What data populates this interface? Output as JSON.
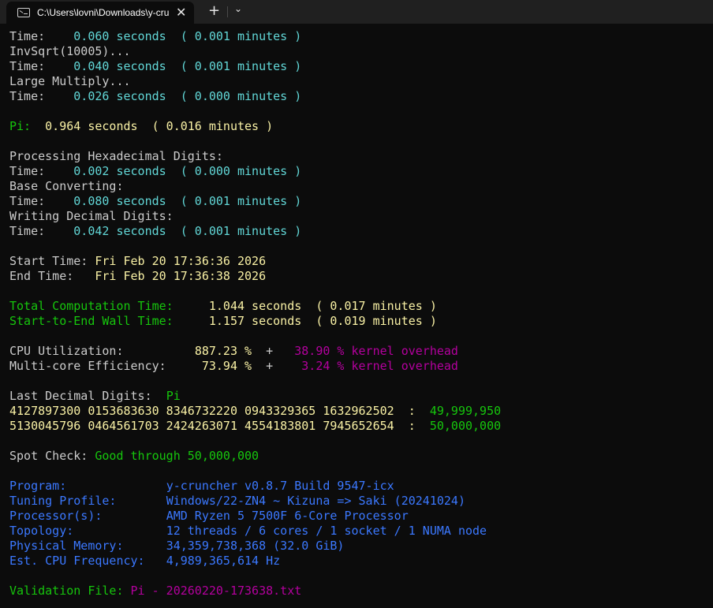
{
  "tab": {
    "title": "C:\\Users\\lovni\\Downloads\\y-cruncher",
    "close_icon": "✕",
    "new_tab_icon": "+",
    "dropdown_icon": "⌄"
  },
  "lines": [
    [
      {
        "t": "Time:    ",
        "c": "w"
      },
      {
        "t": "0.060 seconds  ( 0.001 minutes )",
        "c": "c"
      }
    ],
    [
      {
        "t": "InvSqrt(10005)...",
        "c": "w"
      }
    ],
    [
      {
        "t": "Time:    ",
        "c": "w"
      },
      {
        "t": "0.040 seconds  ( 0.001 minutes )",
        "c": "c"
      }
    ],
    [
      {
        "t": "Large Multiply...",
        "c": "w"
      }
    ],
    [
      {
        "t": "Time:    ",
        "c": "w"
      },
      {
        "t": "0.026 seconds  ( 0.000 minutes )",
        "c": "c"
      }
    ],
    [],
    [
      {
        "t": "Pi:  ",
        "c": "g"
      },
      {
        "t": "0.964 seconds  ( 0.016 minutes )",
        "c": "y"
      }
    ],
    [],
    [
      {
        "t": "Processing Hexadecimal Digits:",
        "c": "w"
      }
    ],
    [
      {
        "t": "Time:    ",
        "c": "w"
      },
      {
        "t": "0.002 seconds  ( 0.000 minutes )",
        "c": "c"
      }
    ],
    [
      {
        "t": "Base Converting:",
        "c": "w"
      }
    ],
    [
      {
        "t": "Time:    ",
        "c": "w"
      },
      {
        "t": "0.080 seconds  ( 0.001 minutes )",
        "c": "c"
      }
    ],
    [
      {
        "t": "Writing Decimal Digits:",
        "c": "w"
      }
    ],
    [
      {
        "t": "Time:    ",
        "c": "w"
      },
      {
        "t": "0.042 seconds  ( 0.001 minutes )",
        "c": "c"
      }
    ],
    [],
    [
      {
        "t": "Start Time: ",
        "c": "w"
      },
      {
        "t": "Fri Feb 20 17:36:36 2026",
        "c": "y"
      }
    ],
    [
      {
        "t": "End Time:   ",
        "c": "w"
      },
      {
        "t": "Fri Feb 20 17:36:38 2026",
        "c": "y"
      }
    ],
    [],
    [
      {
        "t": "Total Computation Time:     ",
        "c": "g"
      },
      {
        "t": "1.044 seconds  ( 0.017 minutes )",
        "c": "y"
      }
    ],
    [
      {
        "t": "Start-to-End Wall Time:     ",
        "c": "g"
      },
      {
        "t": "1.157 seconds  ( 0.019 minutes )",
        "c": "y"
      }
    ],
    [],
    [
      {
        "t": "CPU Utilization:          ",
        "c": "w"
      },
      {
        "t": "887.23 %",
        "c": "y"
      },
      {
        "t": "  +   ",
        "c": "w"
      },
      {
        "t": "38.90 % kernel overhead",
        "c": "m"
      }
    ],
    [
      {
        "t": "Multi-core Efficiency:     ",
        "c": "w"
      },
      {
        "t": "73.94 %",
        "c": "y"
      },
      {
        "t": "  +    ",
        "c": "w"
      },
      {
        "t": "3.24 % kernel overhead",
        "c": "m"
      }
    ],
    [],
    [
      {
        "t": "Last Decimal Digits:  ",
        "c": "w"
      },
      {
        "t": "Pi",
        "c": "g"
      }
    ],
    [
      {
        "t": "4127897300 0153683630 8346732220 0943329365 1632962502  :  ",
        "c": "y"
      },
      {
        "t": "49,999,950",
        "c": "g"
      }
    ],
    [
      {
        "t": "5130045796 0464561703 2424263071 4554183801 7945652654  :  ",
        "c": "y"
      },
      {
        "t": "50,000,000",
        "c": "g"
      }
    ],
    [],
    [
      {
        "t": "Spot Check: ",
        "c": "w"
      },
      {
        "t": "Good through 50,000,000",
        "c": "g"
      }
    ],
    [],
    [
      {
        "t": "Program:              ",
        "c": "b"
      },
      {
        "t": "y-cruncher v0.8.7 Build 9547-icx",
        "c": "b"
      }
    ],
    [
      {
        "t": "Tuning Profile:       ",
        "c": "b"
      },
      {
        "t": "Windows/22-ZN4 ~ Kizuna => Saki (20241024)",
        "c": "b"
      }
    ],
    [
      {
        "t": "Processor(s):         ",
        "c": "b"
      },
      {
        "t": "AMD Ryzen 5 7500F 6-Core Processor",
        "c": "b"
      }
    ],
    [
      {
        "t": "Topology:             ",
        "c": "b"
      },
      {
        "t": "12 threads / 6 cores / 1 socket / 1 NUMA node",
        "c": "b"
      }
    ],
    [
      {
        "t": "Physical Memory:      ",
        "c": "b"
      },
      {
        "t": "34,359,738,368 (32.0 GiB)",
        "c": "b"
      }
    ],
    [
      {
        "t": "Est. CPU Frequency:   ",
        "c": "b"
      },
      {
        "t": "4,989,365,614 Hz",
        "c": "b"
      }
    ],
    [],
    [
      {
        "t": "Validation File: ",
        "c": "g"
      },
      {
        "t": "Pi - 20260220-173638.txt",
        "c": "m"
      }
    ]
  ],
  "colors": {
    "w": "#cccccc",
    "c": "#61d6d6",
    "y": "#f9f1a5",
    "g": "#16c60c",
    "m": "#b4009e",
    "b": "#3b78ff",
    "background": "#0c0c0c"
  }
}
